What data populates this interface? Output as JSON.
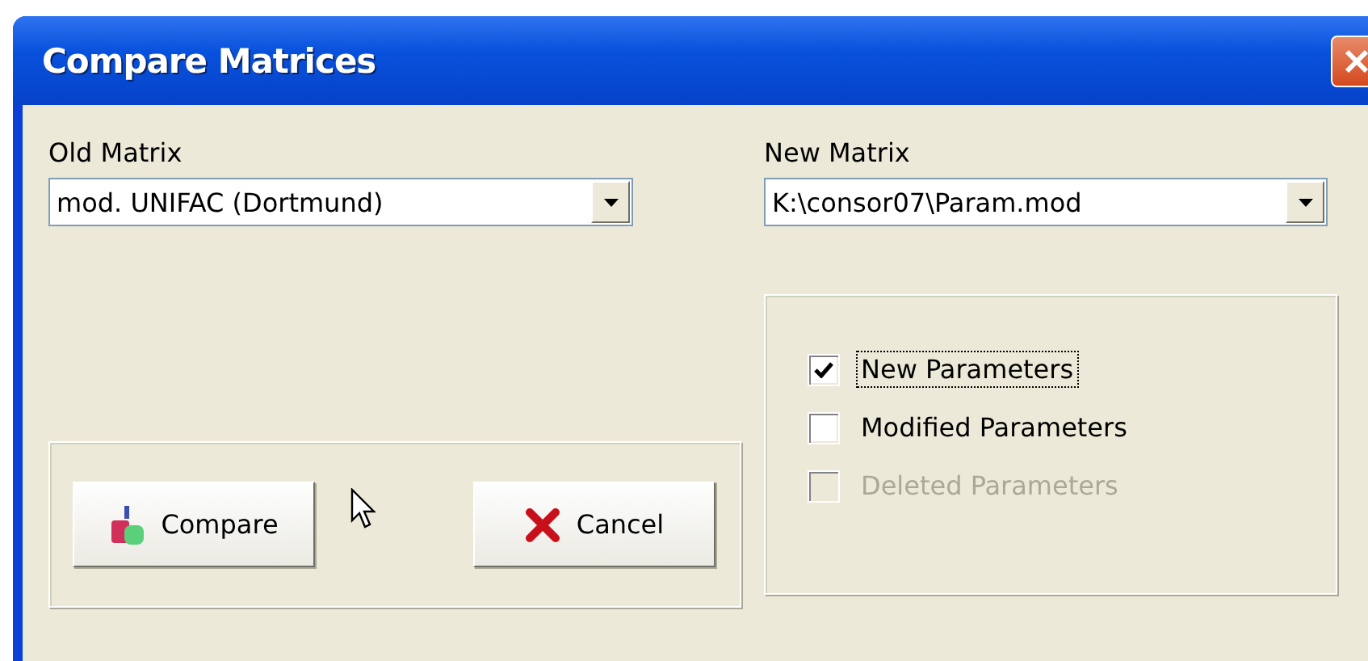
{
  "window": {
    "title": "Compare Matrices"
  },
  "old_matrix": {
    "label": "Old Matrix",
    "value": "mod. UNIFAC (Dortmund)"
  },
  "new_matrix": {
    "label": "New Matrix",
    "value": "K:\\consor07\\Param.mod"
  },
  "buttons": [
    {
      "kind": "compare",
      "label": "Compare"
    },
    {
      "kind": "cancel",
      "label": "Cancel"
    }
  ],
  "options": [
    {
      "label": "New Parameters",
      "checked": true,
      "disabled": false,
      "focused": true
    },
    {
      "label": "Modified Parameters",
      "checked": false,
      "disabled": false,
      "focused": false
    },
    {
      "label": "Deleted Parameters",
      "checked": false,
      "disabled": true,
      "focused": false
    }
  ]
}
